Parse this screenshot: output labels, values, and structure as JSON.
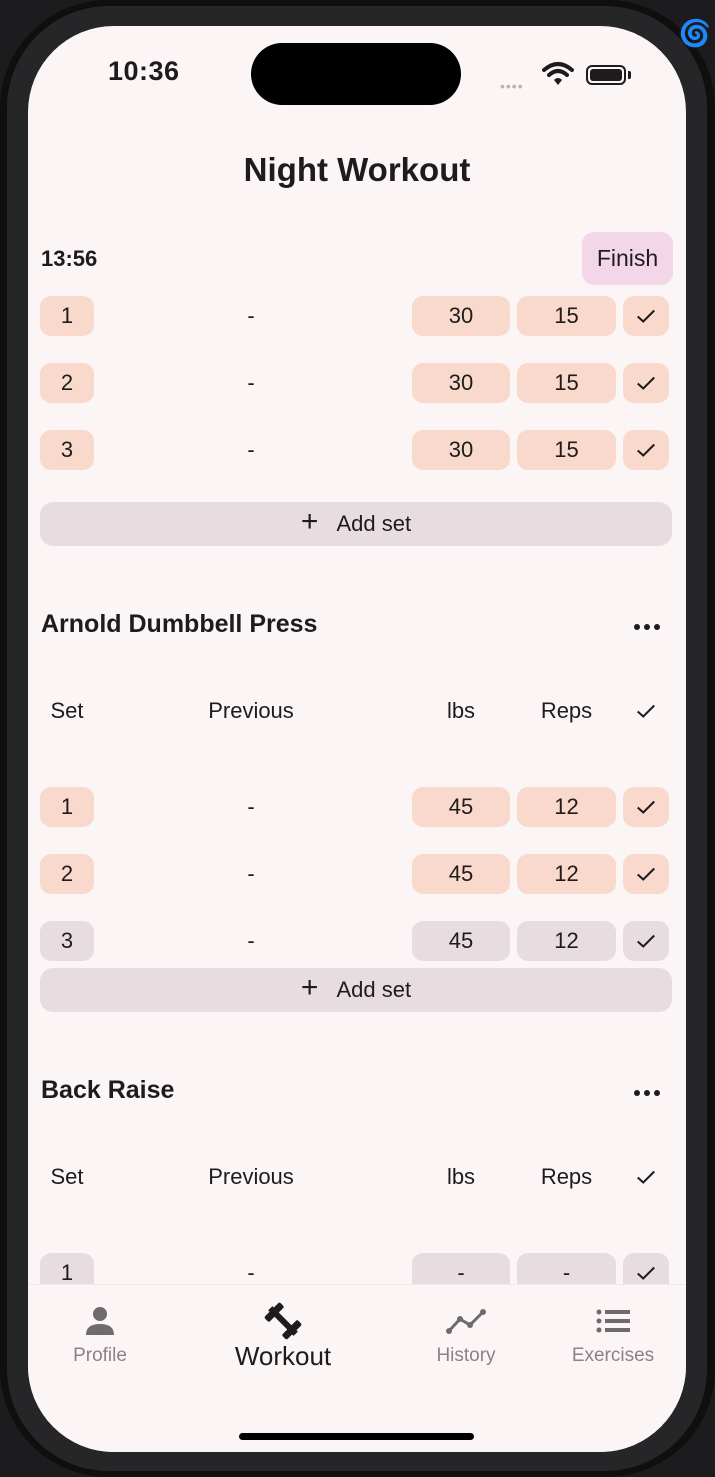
{
  "status_bar": {
    "time": "10:36"
  },
  "workout": {
    "title": "Night Workout",
    "timer": "13:56",
    "finish_label": "Finish"
  },
  "first_exercise": {
    "sets": [
      {
        "set": "1",
        "previous": "-",
        "lbs": "30",
        "reps": "15",
        "completed": true
      },
      {
        "set": "2",
        "previous": "-",
        "lbs": "30",
        "reps": "15",
        "completed": true
      },
      {
        "set": "3",
        "previous": "-",
        "lbs": "30",
        "reps": "15",
        "completed": true
      }
    ],
    "add_set_label": "Add set"
  },
  "columns": {
    "set": "Set",
    "previous": "Previous",
    "lbs": "lbs",
    "reps": "Reps"
  },
  "exercises": [
    {
      "name": "Arnold Dumbbell Press",
      "sets": [
        {
          "set": "1",
          "previous": "-",
          "lbs": "45",
          "reps": "12",
          "completed": true
        },
        {
          "set": "2",
          "previous": "-",
          "lbs": "45",
          "reps": "12",
          "completed": true
        },
        {
          "set": "3",
          "previous": "-",
          "lbs": "45",
          "reps": "12",
          "completed": false
        }
      ],
      "add_set_label": "Add set"
    },
    {
      "name": "Back Raise",
      "sets": [
        {
          "set": "1",
          "previous": "-",
          "lbs": "-",
          "reps": "-",
          "completed": false
        }
      ]
    }
  ],
  "nav": {
    "items": [
      {
        "label": "Profile",
        "icon": "person-icon",
        "active": false
      },
      {
        "label": "Workout",
        "icon": "dumbbell-icon",
        "active": true
      },
      {
        "label": "History",
        "icon": "trend-line-icon",
        "active": false
      },
      {
        "label": "Exercises",
        "icon": "list-icon",
        "active": false
      }
    ]
  },
  "colors": {
    "completed": "#f8d9cb",
    "incomplete": "#e7dde0",
    "finish": "#f4d6e9",
    "background": "#fcf5f5"
  }
}
